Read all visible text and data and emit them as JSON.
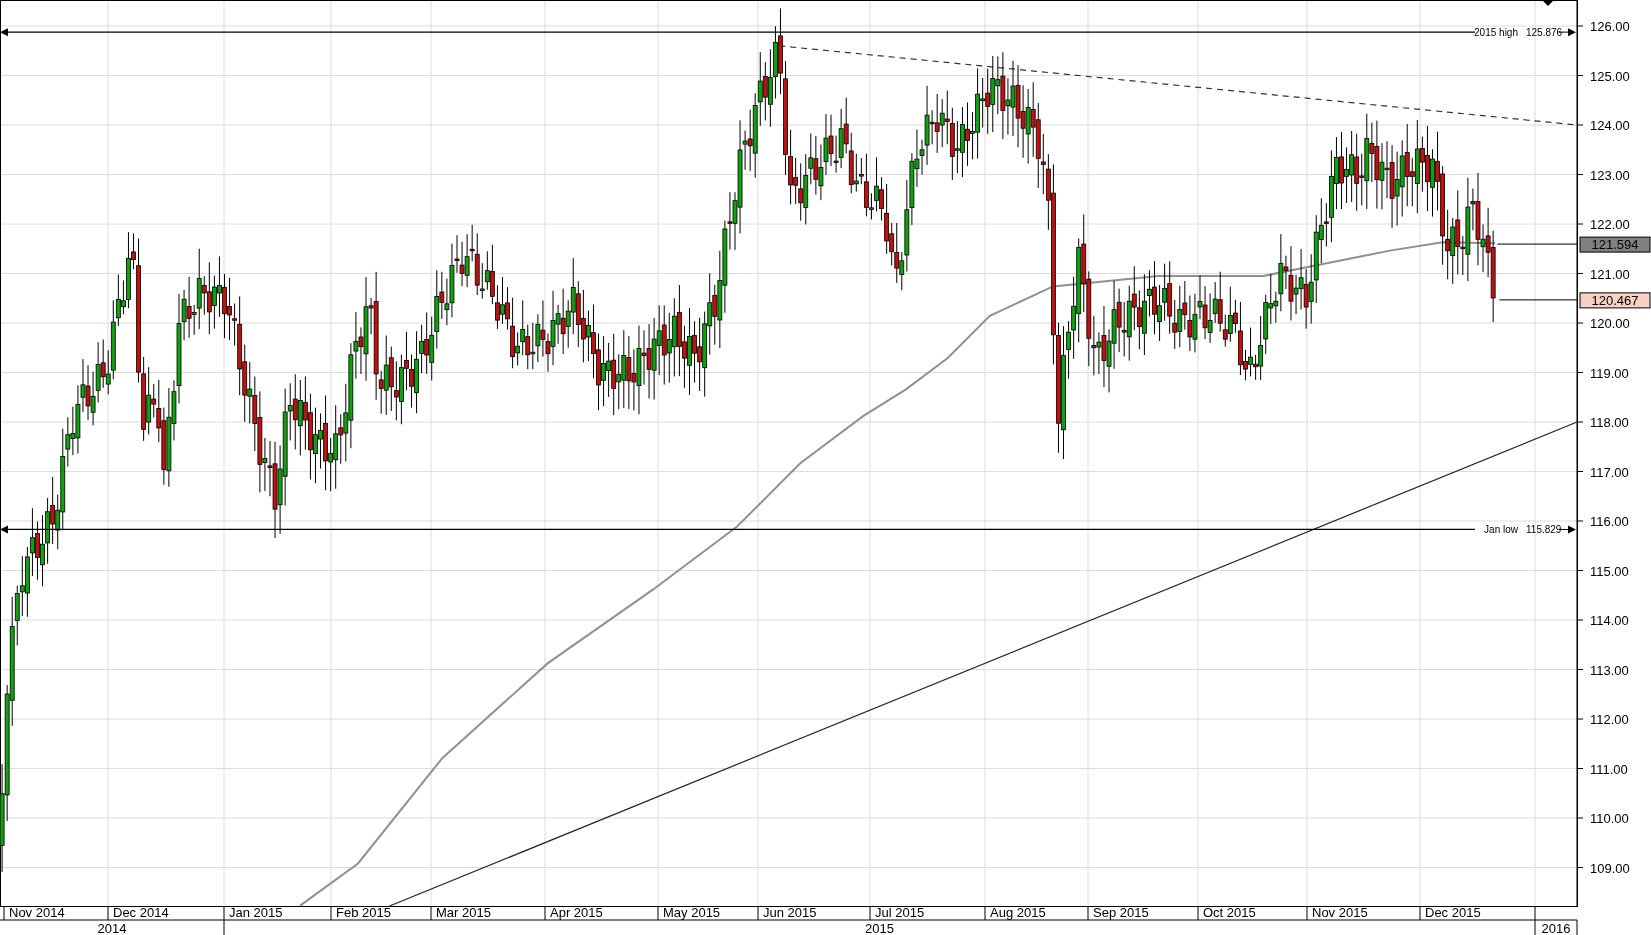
{
  "chart": {
    "y_axis": [
      "126.00",
      "125.00",
      "124.00",
      "123.00",
      "122.00",
      "121.00",
      "120.00",
      "119.00",
      "118.00",
      "117.00",
      "116.00",
      "115.00",
      "114.00",
      "113.00",
      "112.00",
      "111.00",
      "110.00",
      "109.00"
    ],
    "months": [
      "Nov 2014",
      "Dec 2014",
      "Jan 2015",
      "Feb 2015",
      "Mar 2015",
      "Apr 2015",
      "May 2015",
      "Jun 2015",
      "Jul 2015",
      "Aug 2015",
      "Sep 2015",
      "Oct 2015",
      "Nov 2015",
      "Dec 2015"
    ],
    "years": [
      "2014",
      "2015",
      "2016"
    ],
    "levels": [
      {
        "label": "2015 high",
        "value": "125.876"
      },
      {
        "label": "Jan low",
        "value": "115.829"
      }
    ],
    "price_tags": [
      {
        "kind": "average",
        "value": "121.594"
      },
      {
        "kind": "last",
        "value": "120.467"
      }
    ]
  }
}
